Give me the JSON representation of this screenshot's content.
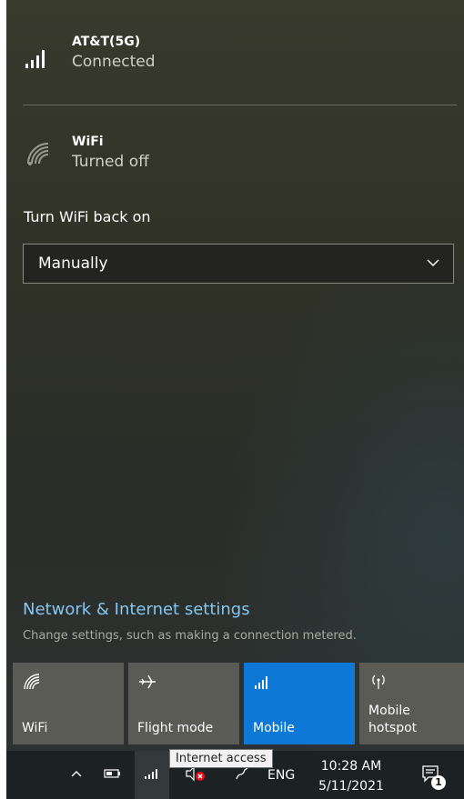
{
  "networks": {
    "cellular": {
      "name": "AT&T(5G)",
      "status": "Connected",
      "icon": "cellular-signal-icon"
    },
    "wifi": {
      "name": "WiFi",
      "status": "Turned off",
      "icon": "wifi-off-icon"
    }
  },
  "wifi_settings": {
    "turn_on_label": "Turn WiFi back on",
    "turn_on_value": "Manually"
  },
  "settings": {
    "link": "Network & Internet settings",
    "description": "Change settings, such as making a connection metered."
  },
  "quick_actions": [
    {
      "label": "WiFi",
      "icon": "wifi-icon",
      "active": false
    },
    {
      "label": "Flight mode",
      "icon": "airplane-icon",
      "active": false
    },
    {
      "label": "Mobile",
      "icon": "cellular-signal-icon",
      "active": true
    },
    {
      "label": "Mobile\nhotspot",
      "icon": "hotspot-icon",
      "active": false
    }
  ],
  "taskbar": {
    "tooltip": "Internet access",
    "language": "ENG",
    "time": "10:28 AM",
    "date": "5/11/2021",
    "notification_count": "1"
  },
  "colors": {
    "accent": "#0d78d6",
    "link": "#86c6ee"
  }
}
